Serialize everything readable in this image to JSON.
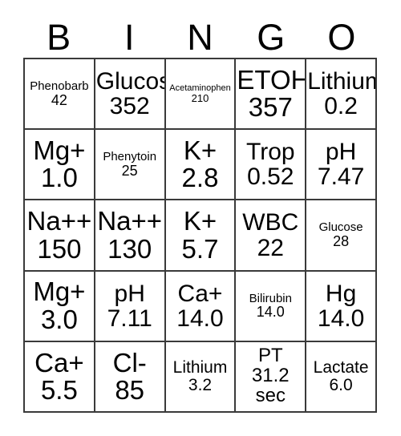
{
  "card": {
    "title": "BINGO",
    "header_letters": [
      "B",
      "I",
      "N",
      "G",
      "O"
    ],
    "border_color": "#3a3a3a",
    "background_color": "#ffffff",
    "text_color": "#000000",
    "columns": 5,
    "rows": 5,
    "cells": [
      [
        {
          "label": "Phenobarb",
          "value": "42",
          "size": "xs"
        },
        {
          "label": "Glucose",
          "value": "352",
          "size": "lg"
        },
        {
          "label": "Acetaminophen",
          "value": "210",
          "size": "xxs"
        },
        {
          "label": "ETOH",
          "value": "357",
          "size": "xl"
        },
        {
          "label": "Lithium",
          "value": "0.2",
          "size": "lg"
        }
      ],
      [
        {
          "label": "Mg+",
          "value": "1.0",
          "size": "xl"
        },
        {
          "label": "Phenytoin",
          "value": "25",
          "size": "xs"
        },
        {
          "label": "K+",
          "value": "2.8",
          "size": "xl"
        },
        {
          "label": "Trop",
          "value": "0.52",
          "size": "lg"
        },
        {
          "label": "pH",
          "value": "7.47",
          "size": "lg"
        }
      ],
      [
        {
          "label": "Na++",
          "value": "150",
          "size": "xl"
        },
        {
          "label": "Na++",
          "value": "130",
          "size": "xl"
        },
        {
          "label": "K+",
          "value": "5.7",
          "size": "xl"
        },
        {
          "label": "WBC",
          "value": "22",
          "size": "lg"
        },
        {
          "label": "Glucose",
          "value": "28",
          "size": "xs"
        }
      ],
      [
        {
          "label": "Mg+",
          "value": "3.0",
          "size": "xl"
        },
        {
          "label": "pH",
          "value": "7.11",
          "size": "lg"
        },
        {
          "label": "Ca+",
          "value": "14.0",
          "size": "lg"
        },
        {
          "label": "Bilirubin",
          "value": "14.0",
          "size": "xs"
        },
        {
          "label": "Hg",
          "value": "14.0",
          "size": "lg"
        }
      ],
      [
        {
          "label": "Ca+",
          "value": "5.5",
          "size": "xl"
        },
        {
          "label": "Cl-",
          "value": "85",
          "size": "xl"
        },
        {
          "label": "Lithium",
          "value": "3.2",
          "size": "sm"
        },
        {
          "label": "PT",
          "value": "31.2",
          "unit": "sec",
          "size": "pt"
        },
        {
          "label": "Lactate",
          "value": "6.0",
          "size": "sm"
        }
      ]
    ]
  }
}
